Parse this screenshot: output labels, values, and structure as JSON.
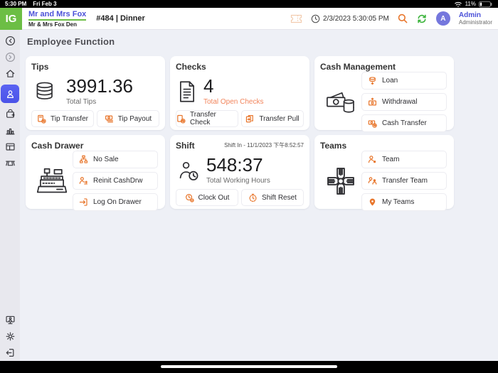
{
  "colors": {
    "accent_orange": "#e8762c",
    "caption_orange": "#f2855c",
    "brand_green": "#6cbe45",
    "link_blue": "#4b51d8",
    "avatar_purple": "#7577dd",
    "refresh_green": "#3bb33b",
    "sidebar_selected": "#5b63f2"
  },
  "status_bar": {
    "time": "5:30 PM",
    "date": "Fri Feb 3",
    "battery_percent": "11%"
  },
  "header": {
    "logo_text": "IG",
    "venue_name": "Mr and Mrs Fox",
    "venue_sub": "Mr & Mrs Fox Den",
    "check_info": "#484 | Dinner",
    "datetime": "2/3/2023 5:30:05 PM",
    "user_name": "Admin",
    "user_role": "Administrator",
    "avatar_letter": "A",
    "icons": [
      "ticket-icon",
      "clock-icon",
      "search-icon",
      "refresh-icon"
    ]
  },
  "sidebar": {
    "items": [
      {
        "name": "back",
        "icon": "chevron-left-circle-icon",
        "selected": false
      },
      {
        "name": "forward",
        "icon": "chevron-right-circle-icon",
        "selected": false
      },
      {
        "name": "home",
        "icon": "home-icon",
        "selected": false
      },
      {
        "name": "employee",
        "icon": "employee-icon",
        "selected": true
      },
      {
        "name": "orders",
        "icon": "bag-plus-icon",
        "selected": false
      },
      {
        "name": "reports",
        "icon": "chart-icon",
        "selected": false
      },
      {
        "name": "layout",
        "icon": "panel-layout-icon",
        "selected": false
      },
      {
        "name": "tables",
        "icon": "table-icon",
        "selected": false
      },
      {
        "name": "kiosk",
        "icon": "monitor-person-icon",
        "selected": false
      },
      {
        "name": "settings",
        "icon": "gear-icon",
        "selected": false
      },
      {
        "name": "logout",
        "icon": "logout-icon",
        "selected": false
      }
    ]
  },
  "page": {
    "title": "Employee Function"
  },
  "cards": {
    "tips": {
      "title": "Tips",
      "icon": "coins-icon",
      "value": "3991.36",
      "caption": "Total Tips",
      "buttons": [
        {
          "label": "Tip Transfer",
          "icon": "tip-transfer-icon"
        },
        {
          "label": "Tip Payout",
          "icon": "tip-payout-icon"
        }
      ]
    },
    "checks": {
      "title": "Checks",
      "icon": "check-document-icon",
      "value": "4",
      "caption": "Total Open Checks",
      "buttons": [
        {
          "label": "Transfer Check",
          "icon": "transfer-check-icon"
        },
        {
          "label": "Transfer Pull",
          "icon": "transfer-pull-icon"
        }
      ]
    },
    "cash_management": {
      "title": "Cash Management",
      "icon": "cash-coins-icon",
      "buttons": [
        {
          "label": "Loan",
          "icon": "loan-icon"
        },
        {
          "label": "Withdrawal",
          "icon": "withdrawal-icon"
        },
        {
          "label": "Cash Transfer",
          "icon": "cash-transfer-icon"
        }
      ]
    },
    "cash_drawer": {
      "title": "Cash Drawer",
      "icon": "cash-register-icon",
      "buttons": [
        {
          "label": "No Sale",
          "icon": "no-sale-icon"
        },
        {
          "label": "Reinit CashDrw",
          "icon": "reinit-cashdrawer-icon"
        },
        {
          "label": "Log On Drawer",
          "icon": "log-on-drawer-icon"
        }
      ]
    },
    "shift": {
      "title": "Shift",
      "shift_in": "Shift In - 11/1/2023 下午8:52:57",
      "icon": "employee-clock-icon",
      "value": "548:37",
      "caption": "Total Working Hours",
      "buttons": [
        {
          "label": "Clock Out",
          "icon": "clock-out-icon"
        },
        {
          "label": "Shift Reset",
          "icon": "shift-reset-icon"
        }
      ]
    },
    "teams": {
      "title": "Teams",
      "icon": "teamwork-hands-icon",
      "buttons": [
        {
          "label": "Team",
          "icon": "team-icon"
        },
        {
          "label": "Transfer Team",
          "icon": "transfer-team-icon"
        },
        {
          "label": "My Teams",
          "icon": "my-teams-icon"
        }
      ]
    }
  }
}
